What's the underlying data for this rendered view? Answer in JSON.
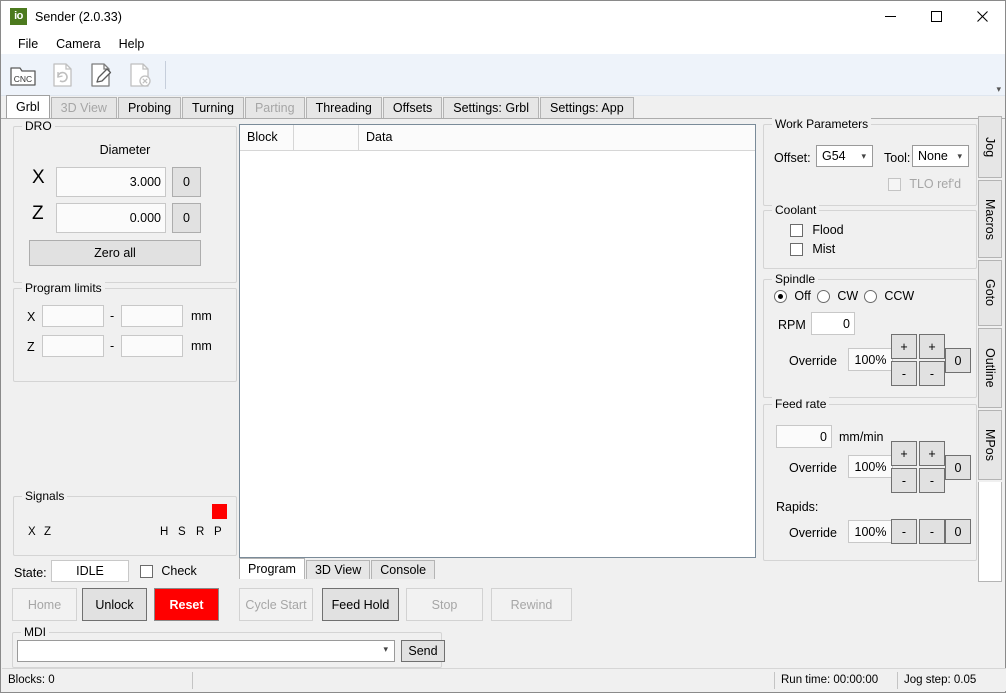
{
  "window": {
    "title": "Sender (2.0.33)",
    "app_icon_text": "io",
    "minimize": "minimize-icon",
    "maximize": "maximize-icon",
    "close": "close-icon"
  },
  "menu": {
    "items": [
      "File",
      "Camera",
      "Help"
    ]
  },
  "toolbar": {
    "buttons": [
      {
        "name": "open-cnc-file-icon",
        "label": "CNC"
      },
      {
        "name": "reload-file-icon",
        "label": ""
      },
      {
        "name": "edit-file-icon",
        "label": ""
      },
      {
        "name": "close-file-icon",
        "label": ""
      }
    ],
    "overflow": "▾"
  },
  "tabs": [
    {
      "label": "Grbl",
      "active": true,
      "enabled": true
    },
    {
      "label": "3D View",
      "active": false,
      "enabled": false
    },
    {
      "label": "Probing",
      "active": false,
      "enabled": true
    },
    {
      "label": "Turning",
      "active": false,
      "enabled": true
    },
    {
      "label": "Parting",
      "active": false,
      "enabled": false
    },
    {
      "label": "Threading",
      "active": false,
      "enabled": true
    },
    {
      "label": "Offsets",
      "active": false,
      "enabled": true
    },
    {
      "label": "Settings: Grbl",
      "active": false,
      "enabled": true
    },
    {
      "label": "Settings: App",
      "active": false,
      "enabled": true
    }
  ],
  "dro": {
    "title": "DRO",
    "mode_label": "Diameter",
    "axes": [
      {
        "name": "X",
        "value": "3.000",
        "zero_button": "0"
      },
      {
        "name": "Z",
        "value": "0.000",
        "zero_button": "0"
      }
    ],
    "zero_all": "Zero all"
  },
  "program_limits": {
    "title": "Program limits",
    "rows": [
      {
        "axis": "X",
        "min": "",
        "max": "",
        "unit": "mm",
        "sep": "-"
      },
      {
        "axis": "Z",
        "min": "",
        "max": "",
        "unit": "mm",
        "sep": "-"
      }
    ]
  },
  "signals": {
    "title": "Signals",
    "left": [
      "X",
      "Z"
    ],
    "right": [
      "H",
      "S",
      "R",
      "P"
    ],
    "alarm_color": "#ff0000",
    "alarm_on": "P"
  },
  "state": {
    "label": "State:",
    "value": "IDLE",
    "check_label": "Check",
    "check_checked": false
  },
  "controls": {
    "buttons": [
      {
        "label": "Home",
        "enabled": false,
        "style": "normal"
      },
      {
        "label": "Unlock",
        "enabled": true,
        "style": "normal"
      },
      {
        "label": "Reset",
        "enabled": true,
        "style": "red"
      },
      {
        "label": "Cycle Start",
        "enabled": false,
        "style": "normal"
      },
      {
        "label": "Feed Hold",
        "enabled": true,
        "style": "normal"
      },
      {
        "label": "Stop",
        "enabled": false,
        "style": "normal"
      },
      {
        "label": "Rewind",
        "enabled": false,
        "style": "normal"
      }
    ]
  },
  "mdi": {
    "title": "MDI",
    "value": "",
    "placeholder": "",
    "send_label": "Send",
    "dropdown_icon": "chevron-down-icon"
  },
  "program_grid": {
    "columns": [
      "Block",
      "",
      "Data"
    ],
    "rows": []
  },
  "bottom_tabs": [
    {
      "label": "Program",
      "active": true
    },
    {
      "label": "3D View",
      "active": false
    },
    {
      "label": "Console",
      "active": false
    }
  ],
  "work_parameters": {
    "title": "Work Parameters",
    "offset_label": "Offset:",
    "offset_value": "G54",
    "tool_label": "Tool:",
    "tool_value": "None",
    "tlo_label": "TLO ref'd",
    "tlo_checked": false,
    "tlo_enabled": false
  },
  "coolant": {
    "title": "Coolant",
    "items": [
      {
        "label": "Flood",
        "checked": false
      },
      {
        "label": "Mist",
        "checked": false
      }
    ]
  },
  "spindle": {
    "title": "Spindle",
    "modes": [
      {
        "label": "Off",
        "selected": true
      },
      {
        "label": "CW",
        "selected": false
      },
      {
        "label": "CCW",
        "selected": false
      }
    ],
    "rpm_label": "RPM",
    "rpm_value": "0",
    "override_label": "Override",
    "override_value": "100%",
    "plus_coarse": "+",
    "minus_coarse": "-",
    "plus_fine": "+",
    "minus_fine": "-",
    "reset_label": "0"
  },
  "feed_rate": {
    "title": "Feed rate",
    "value": "0",
    "unit": "mm/min",
    "override_label": "Override",
    "override_value": "100%",
    "plus_coarse": "+",
    "minus_coarse": "-",
    "plus_fine": "+",
    "minus_fine": "-",
    "reset_label": "0",
    "rapids_label": "Rapids:",
    "rapids_override_label": "Override",
    "rapids_override_value": "100%",
    "rapids_minus_coarse": "-",
    "rapids_minus_fine": "-",
    "rapids_reset": "0"
  },
  "side_tabs": [
    {
      "label": "Jog",
      "active": false
    },
    {
      "label": "Macros",
      "active": false
    },
    {
      "label": "Goto",
      "active": false
    },
    {
      "label": "Outline",
      "active": false
    },
    {
      "label": "MPos",
      "active": false
    }
  ],
  "statusbar": {
    "blocks": "Blocks: 0",
    "middle": "",
    "run_time": "Run time: 00:00:00",
    "jog_step": "Jog step: 0.05"
  }
}
